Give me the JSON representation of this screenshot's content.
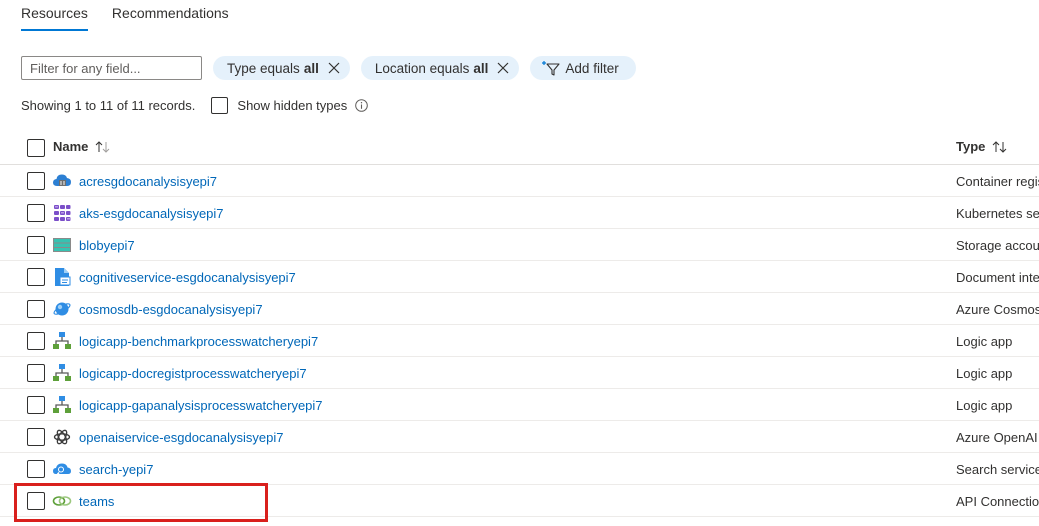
{
  "tabs": [
    {
      "label": "Resources",
      "active": true
    },
    {
      "label": "Recommendations",
      "active": false
    }
  ],
  "filter": {
    "placeholder": "Filter for any field...",
    "pills": [
      {
        "prefix": "Type equals",
        "value": "all"
      },
      {
        "prefix": "Location equals",
        "value": "all"
      }
    ],
    "add_filter_label": "Add filter"
  },
  "records": {
    "summary": "Showing 1 to 11 of 11 records.",
    "show_hidden_label": "Show hidden types"
  },
  "table": {
    "columns": {
      "name": "Name",
      "type": "Type"
    },
    "rows": [
      {
        "name": "acresgdocanalysisyepi7",
        "type": "Container regis",
        "icon": "container-registry-icon"
      },
      {
        "name": "aks-esgdocanalysisyepi7",
        "type": "Kubernetes ser",
        "icon": "kubernetes-service-icon"
      },
      {
        "name": "blobyepi7",
        "type": "Storage accou",
        "icon": "storage-account-icon"
      },
      {
        "name": "cognitiveservice-esgdocanalysisyepi7",
        "type": "Document inte",
        "icon": "document-intelligence-icon"
      },
      {
        "name": "cosmosdb-esgdocanalysisyepi7",
        "type": "Azure Cosmos",
        "icon": "cosmos-db-icon"
      },
      {
        "name": "logicapp-benchmarkprocesswatcheryepi7",
        "type": "Logic app",
        "icon": "logic-app-icon"
      },
      {
        "name": "logicapp-docregistprocesswatcheryepi7",
        "type": "Logic app",
        "icon": "logic-app-icon"
      },
      {
        "name": "logicapp-gapanalysisprocesswatcheryepi7",
        "type": "Logic app",
        "icon": "logic-app-icon"
      },
      {
        "name": "openaiservice-esgdocanalysisyepi7",
        "type": "Azure OpenAI",
        "icon": "openai-icon"
      },
      {
        "name": "search-yepi7",
        "type": "Search service",
        "icon": "search-service-icon"
      },
      {
        "name": "teams",
        "type": "API Connection",
        "icon": "api-connection-icon"
      }
    ]
  },
  "colors": {
    "accent": "#0078d4",
    "link": "#0067b8",
    "pill_bg": "#e5f1fb",
    "highlight": "#d9201d"
  }
}
